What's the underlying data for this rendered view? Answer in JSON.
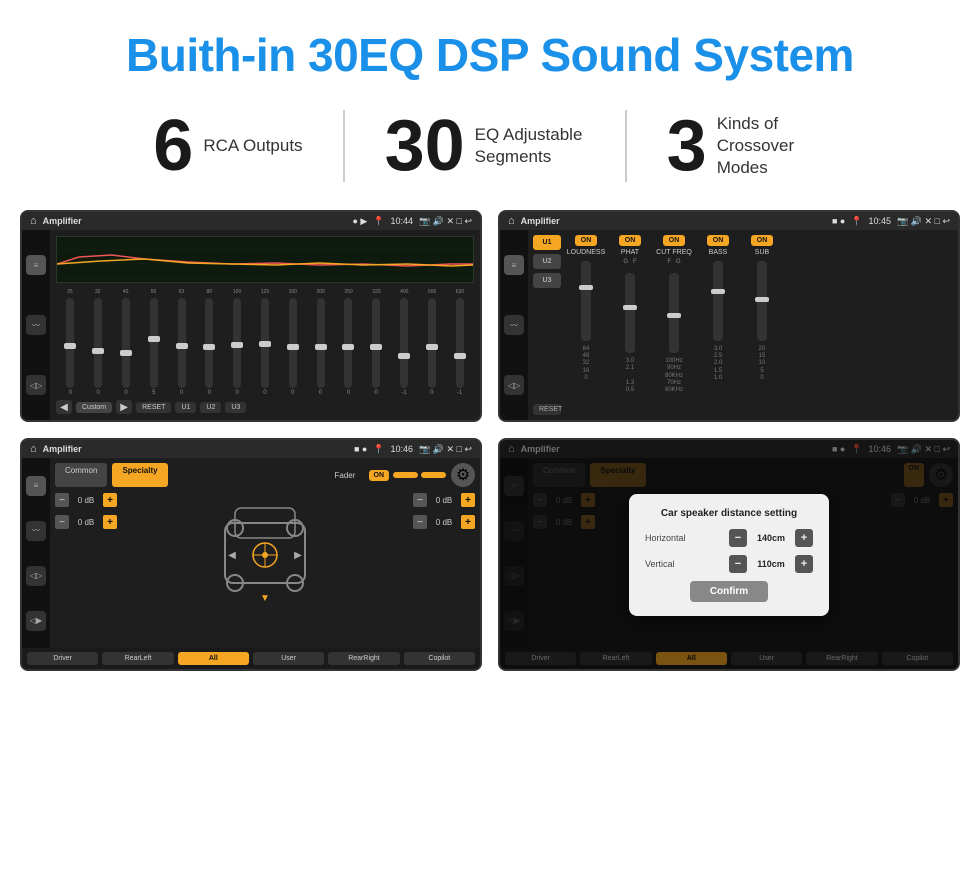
{
  "header": {
    "title": "Buith-in 30EQ DSP Sound System"
  },
  "stats": [
    {
      "number": "6",
      "text": "RCA\nOutputs"
    },
    {
      "number": "30",
      "text": "EQ Adjustable\nSegments"
    },
    {
      "number": "3",
      "text": "Kinds of\nCrossover Modes"
    }
  ],
  "screens": [
    {
      "id": "screen1",
      "status_bar": {
        "app": "Amplifier",
        "time": "10:44"
      },
      "type": "eq"
    },
    {
      "id": "screen2",
      "status_bar": {
        "app": "Amplifier",
        "time": "10:45"
      },
      "type": "amp"
    },
    {
      "id": "screen3",
      "status_bar": {
        "app": "Amplifier",
        "time": "10:46"
      },
      "type": "fader"
    },
    {
      "id": "screen4",
      "status_bar": {
        "app": "Amplifier",
        "time": "10:46"
      },
      "type": "dialog"
    }
  ],
  "eq": {
    "frequencies": [
      "25",
      "32",
      "40",
      "50",
      "63",
      "80",
      "100",
      "125",
      "160",
      "200",
      "250",
      "320",
      "400",
      "500",
      "630"
    ],
    "values": [
      "0",
      "0",
      "0",
      "5",
      "0",
      "0",
      "0",
      "0",
      "0",
      "0",
      "0",
      "0",
      "-1",
      "0",
      "-1"
    ],
    "preset": "Custom",
    "buttons": [
      "RESET",
      "U1",
      "U2",
      "U3"
    ]
  },
  "amp": {
    "presets": [
      "U1",
      "U2",
      "U3"
    ],
    "toggles": [
      "ON",
      "ON",
      "ON",
      "ON",
      "ON"
    ],
    "labels": [
      "LOUDNESS",
      "PHAT",
      "CUT FREQ",
      "BASS",
      "SUB"
    ],
    "reset": "RESET"
  },
  "fader": {
    "tabs": [
      "Common",
      "Specialty"
    ],
    "fader_label": "Fader",
    "fader_on": "ON",
    "db_values": [
      "0 dB",
      "0 dB",
      "0 dB",
      "0 dB"
    ],
    "buttons": [
      "Driver",
      "RearLeft",
      "All",
      "User",
      "RearRight",
      "Copilot"
    ]
  },
  "dialog": {
    "title": "Car speaker distance setting",
    "horizontal_label": "Horizontal",
    "horizontal_value": "140cm",
    "vertical_label": "Vertical",
    "vertical_value": "110cm",
    "confirm_label": "Confirm",
    "db_values": [
      "0 dB",
      "0 dB"
    ],
    "buttons": [
      "Driver",
      "RearLeft",
      "All",
      "User",
      "RearRight",
      "Copilot"
    ]
  }
}
